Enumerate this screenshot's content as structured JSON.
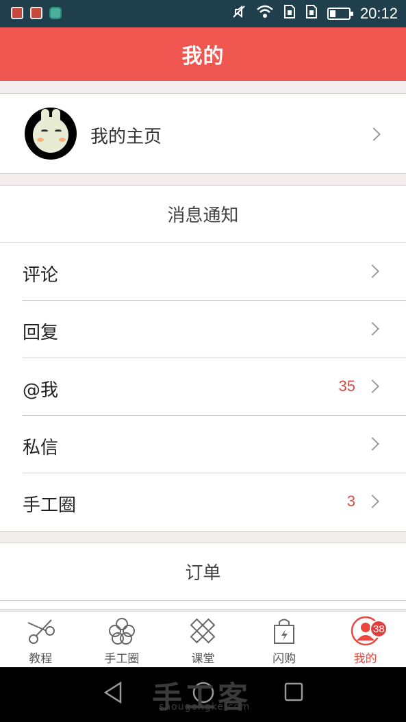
{
  "status_bar": {
    "time": "20:12",
    "icons": [
      "notification-app-icon",
      "notification-app-icon",
      "huawei-app-icon",
      "mute-icon",
      "wifi-icon",
      "sim1-icon",
      "sim2-icon",
      "battery-icon"
    ]
  },
  "header": {
    "title": "我的"
  },
  "profile": {
    "label": "我的主页"
  },
  "messages": {
    "header": "消息通知",
    "items": [
      {
        "label": "评论",
        "count": ""
      },
      {
        "label": "回复",
        "count": ""
      },
      {
        "label": "@我",
        "count": "35"
      },
      {
        "label": "私信",
        "count": ""
      },
      {
        "label": "手工圈",
        "count": "3"
      }
    ]
  },
  "orders": {
    "header": "订单"
  },
  "tabs": [
    {
      "label": "教程",
      "icon": "scissors-icon",
      "active": false
    },
    {
      "label": "手工圈",
      "icon": "flower-icon",
      "active": false
    },
    {
      "label": "课堂",
      "icon": "pencil-ruler-icon",
      "active": false
    },
    {
      "label": "闪购",
      "icon": "shopping-bag-icon",
      "active": false
    },
    {
      "label": "我的",
      "icon": "user-icon",
      "active": true,
      "badge": "38"
    }
  ],
  "watermark": {
    "main": "手工客",
    "sub": "shougongke.com"
  },
  "colors": {
    "accent": "#ef5650",
    "status_bar": "#1f3f4c",
    "count_text": "#d64a44"
  }
}
